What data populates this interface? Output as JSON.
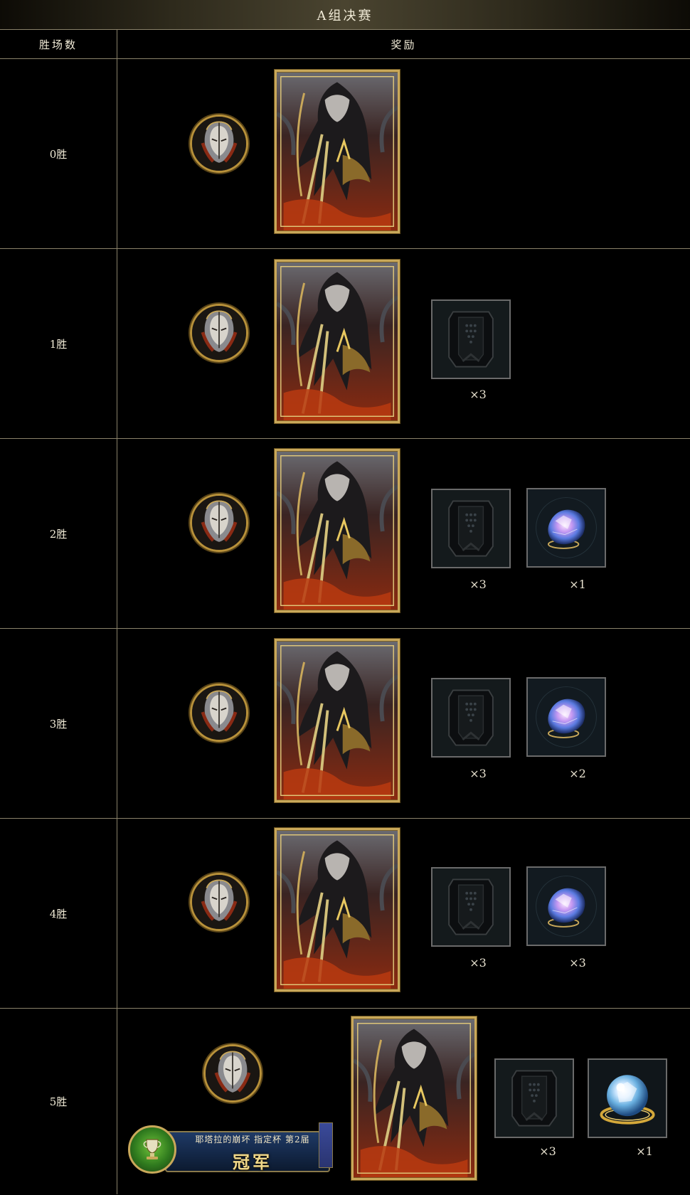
{
  "title": "A组决赛",
  "header": {
    "wins_label": "胜场数",
    "reward_label": "奖励"
  },
  "colors": {
    "gold_border": "#c9a85a",
    "row_divider": "#8a826a",
    "text": "#f0ead6"
  },
  "rows": [
    {
      "wins": "0胜",
      "items": []
    },
    {
      "wins": "1胜",
      "items": [
        {
          "icon": "card-pack-icon",
          "qty": "×3"
        }
      ]
    },
    {
      "wins": "2胜",
      "items": [
        {
          "icon": "card-pack-icon",
          "qty": "×3"
        },
        {
          "icon": "crystal-icon",
          "qty": "×1"
        }
      ]
    },
    {
      "wins": "3胜",
      "items": [
        {
          "icon": "card-pack-icon",
          "qty": "×3"
        },
        {
          "icon": "crystal-icon",
          "qty": "×2"
        }
      ]
    },
    {
      "wins": "4胜",
      "items": [
        {
          "icon": "card-pack-icon",
          "qty": "×3"
        },
        {
          "icon": "crystal-icon",
          "qty": "×3"
        }
      ]
    },
    {
      "wins": "5胜",
      "items": [
        {
          "icon": "card-pack-icon",
          "qty": "×3"
        },
        {
          "icon": "orb-icon",
          "qty": "×1"
        }
      ]
    }
  ],
  "champion_badge": {
    "subtitle": "耶塔拉的崩坏 指定杯 第2届",
    "label": "冠军"
  }
}
